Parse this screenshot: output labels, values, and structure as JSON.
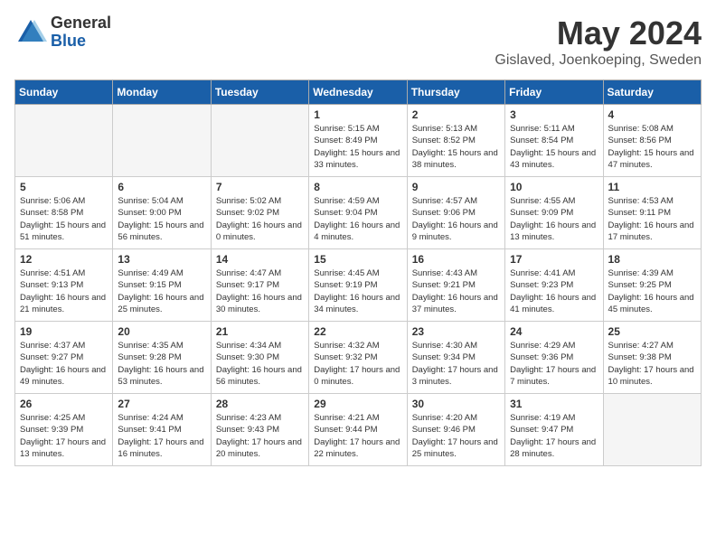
{
  "header": {
    "logo_general": "General",
    "logo_blue": "Blue",
    "month_title": "May 2024",
    "location": "Gislaved, Joenkoeping, Sweden"
  },
  "days_of_week": [
    "Sunday",
    "Monday",
    "Tuesday",
    "Wednesday",
    "Thursday",
    "Friday",
    "Saturday"
  ],
  "weeks": [
    [
      {
        "day": "",
        "empty": true
      },
      {
        "day": "",
        "empty": true
      },
      {
        "day": "",
        "empty": true
      },
      {
        "day": "1",
        "sunrise": "5:15 AM",
        "sunset": "8:49 PM",
        "daylight": "15 hours and 33 minutes."
      },
      {
        "day": "2",
        "sunrise": "5:13 AM",
        "sunset": "8:52 PM",
        "daylight": "15 hours and 38 minutes."
      },
      {
        "day": "3",
        "sunrise": "5:11 AM",
        "sunset": "8:54 PM",
        "daylight": "15 hours and 43 minutes."
      },
      {
        "day": "4",
        "sunrise": "5:08 AM",
        "sunset": "8:56 PM",
        "daylight": "15 hours and 47 minutes."
      }
    ],
    [
      {
        "day": "5",
        "sunrise": "5:06 AM",
        "sunset": "8:58 PM",
        "daylight": "15 hours and 51 minutes."
      },
      {
        "day": "6",
        "sunrise": "5:04 AM",
        "sunset": "9:00 PM",
        "daylight": "15 hours and 56 minutes."
      },
      {
        "day": "7",
        "sunrise": "5:02 AM",
        "sunset": "9:02 PM",
        "daylight": "16 hours and 0 minutes."
      },
      {
        "day": "8",
        "sunrise": "4:59 AM",
        "sunset": "9:04 PM",
        "daylight": "16 hours and 4 minutes."
      },
      {
        "day": "9",
        "sunrise": "4:57 AM",
        "sunset": "9:06 PM",
        "daylight": "16 hours and 9 minutes."
      },
      {
        "day": "10",
        "sunrise": "4:55 AM",
        "sunset": "9:09 PM",
        "daylight": "16 hours and 13 minutes."
      },
      {
        "day": "11",
        "sunrise": "4:53 AM",
        "sunset": "9:11 PM",
        "daylight": "16 hours and 17 minutes."
      }
    ],
    [
      {
        "day": "12",
        "sunrise": "4:51 AM",
        "sunset": "9:13 PM",
        "daylight": "16 hours and 21 minutes."
      },
      {
        "day": "13",
        "sunrise": "4:49 AM",
        "sunset": "9:15 PM",
        "daylight": "16 hours and 25 minutes."
      },
      {
        "day": "14",
        "sunrise": "4:47 AM",
        "sunset": "9:17 PM",
        "daylight": "16 hours and 30 minutes."
      },
      {
        "day": "15",
        "sunrise": "4:45 AM",
        "sunset": "9:19 PM",
        "daylight": "16 hours and 34 minutes."
      },
      {
        "day": "16",
        "sunrise": "4:43 AM",
        "sunset": "9:21 PM",
        "daylight": "16 hours and 37 minutes."
      },
      {
        "day": "17",
        "sunrise": "4:41 AM",
        "sunset": "9:23 PM",
        "daylight": "16 hours and 41 minutes."
      },
      {
        "day": "18",
        "sunrise": "4:39 AM",
        "sunset": "9:25 PM",
        "daylight": "16 hours and 45 minutes."
      }
    ],
    [
      {
        "day": "19",
        "sunrise": "4:37 AM",
        "sunset": "9:27 PM",
        "daylight": "16 hours and 49 minutes."
      },
      {
        "day": "20",
        "sunrise": "4:35 AM",
        "sunset": "9:28 PM",
        "daylight": "16 hours and 53 minutes."
      },
      {
        "day": "21",
        "sunrise": "4:34 AM",
        "sunset": "9:30 PM",
        "daylight": "16 hours and 56 minutes."
      },
      {
        "day": "22",
        "sunrise": "4:32 AM",
        "sunset": "9:32 PM",
        "daylight": "17 hours and 0 minutes."
      },
      {
        "day": "23",
        "sunrise": "4:30 AM",
        "sunset": "9:34 PM",
        "daylight": "17 hours and 3 minutes."
      },
      {
        "day": "24",
        "sunrise": "4:29 AM",
        "sunset": "9:36 PM",
        "daylight": "17 hours and 7 minutes."
      },
      {
        "day": "25",
        "sunrise": "4:27 AM",
        "sunset": "9:38 PM",
        "daylight": "17 hours and 10 minutes."
      }
    ],
    [
      {
        "day": "26",
        "sunrise": "4:25 AM",
        "sunset": "9:39 PM",
        "daylight": "17 hours and 13 minutes."
      },
      {
        "day": "27",
        "sunrise": "4:24 AM",
        "sunset": "9:41 PM",
        "daylight": "17 hours and 16 minutes."
      },
      {
        "day": "28",
        "sunrise": "4:23 AM",
        "sunset": "9:43 PM",
        "daylight": "17 hours and 20 minutes."
      },
      {
        "day": "29",
        "sunrise": "4:21 AM",
        "sunset": "9:44 PM",
        "daylight": "17 hours and 22 minutes."
      },
      {
        "day": "30",
        "sunrise": "4:20 AM",
        "sunset": "9:46 PM",
        "daylight": "17 hours and 25 minutes."
      },
      {
        "day": "31",
        "sunrise": "4:19 AM",
        "sunset": "9:47 PM",
        "daylight": "17 hours and 28 minutes."
      },
      {
        "day": "",
        "empty": true
      }
    ]
  ]
}
